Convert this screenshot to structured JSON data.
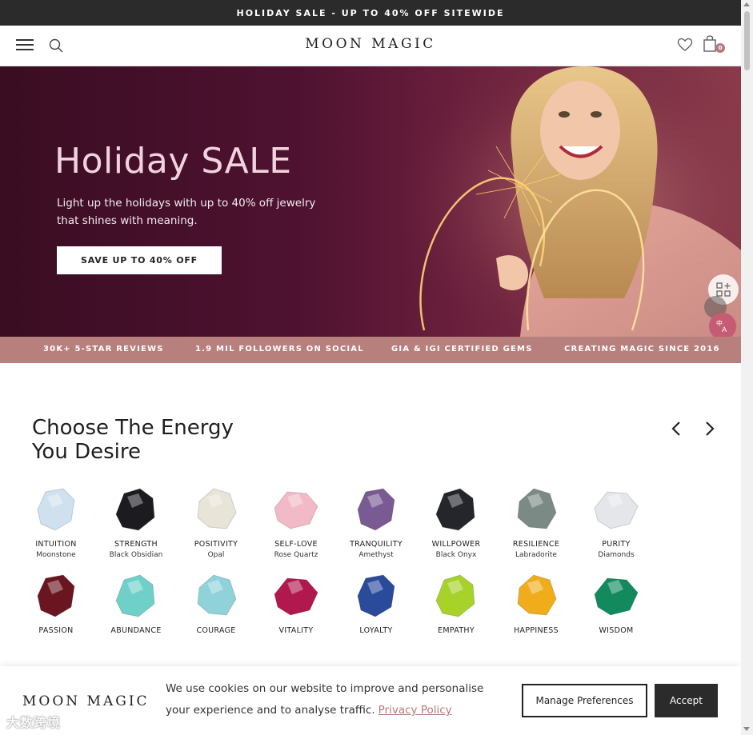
{
  "announcement": "HOLIDAY SALE - UP TO 40% OFF SITEWIDE",
  "header": {
    "logo": "MOON MAGIC",
    "cart_count": "0",
    "icons": [
      "menu-icon",
      "search-icon",
      "heart-icon",
      "shopping-bag-icon"
    ]
  },
  "hero": {
    "title": "Holiday SALE",
    "text": "Light up the holidays with up to 40% off jewelry that shines with meaning.",
    "button": "SAVE UP TO 40% OFF"
  },
  "trust_bar": [
    "30K+ 5-STAR REVIEWS",
    "1.9 MIL FOLLOWERS ON SOCIAL",
    "GIA & IGI CERTIFIED GEMS",
    "CREATING MAGIC SINCE 2016"
  ],
  "energy": {
    "title": "Choose The Energy You Desire",
    "row1": [
      {
        "name": "INTUITION",
        "stone": "Moonstone",
        "color": "#cfe0ee"
      },
      {
        "name": "STRENGTH",
        "stone": "Black Obsidian",
        "color": "#1c1c20"
      },
      {
        "name": "POSITIVITY",
        "stone": "Opal",
        "color": "#e9e4d8"
      },
      {
        "name": "SELF-LOVE",
        "stone": "Rose Quartz",
        "color": "#f2b9c6"
      },
      {
        "name": "TRANQUILITY",
        "stone": "Amethyst",
        "color": "#7a5a92"
      },
      {
        "name": "WILLPOWER",
        "stone": "Black Onyx",
        "color": "#24262b"
      },
      {
        "name": "RESILIENCE",
        "stone": "Labradorite",
        "color": "#7c8a86"
      },
      {
        "name": "PURITY",
        "stone": "Diamonds",
        "color": "#e4e6ea"
      }
    ],
    "row2": [
      {
        "name": "PASSION",
        "color": "#6a1620"
      },
      {
        "name": "ABUNDANCE",
        "color": "#6fd0c9"
      },
      {
        "name": "COURAGE",
        "color": "#8fd2d9"
      },
      {
        "name": "VITALITY",
        "color": "#b0184e"
      },
      {
        "name": "LOYALTY",
        "color": "#2a4b9a"
      },
      {
        "name": "EMPATHY",
        "color": "#a6d22a"
      },
      {
        "name": "HAPPINESS",
        "color": "#f1ac1c"
      },
      {
        "name": "WISDOM",
        "color": "#128a5e"
      }
    ]
  },
  "cookie": {
    "logo": "MOON MAGIC",
    "text": "We use cookies on our website to improve and personalise your experience and to analyse traffic.",
    "link": "Privacy Policy",
    "manage": "Manage Preferences",
    "accept": "Accept"
  },
  "watermark": "大数跨境",
  "colors": {
    "announcement_bg": "#2b2b2b",
    "trust_bg": "#b8807d",
    "accent": "#b57a7d",
    "hero_bg": "#4e1230"
  }
}
